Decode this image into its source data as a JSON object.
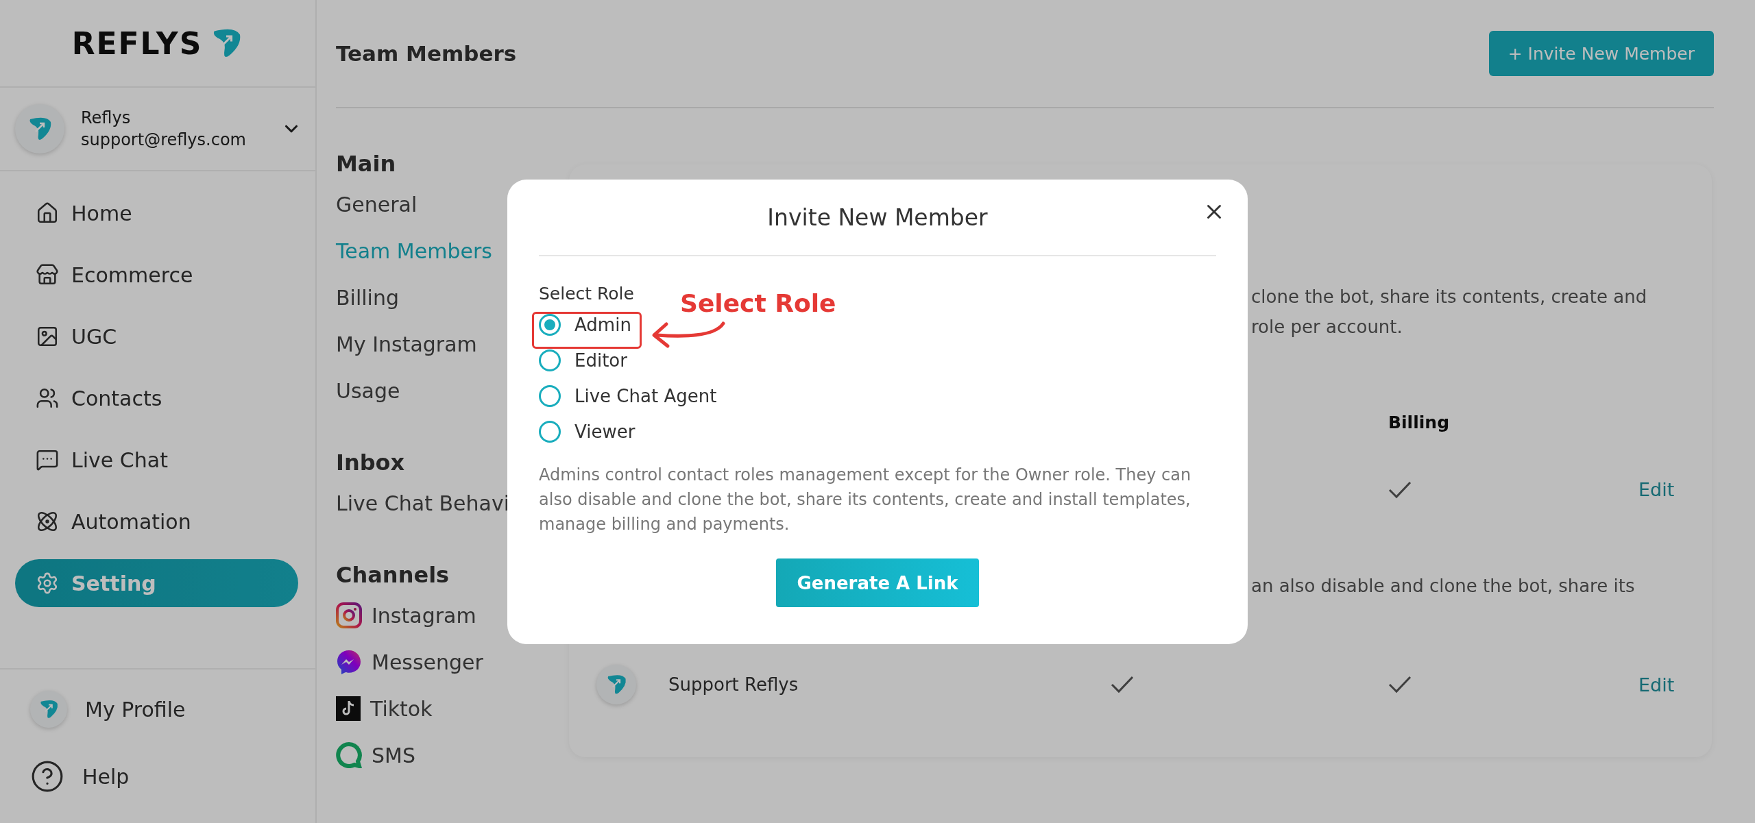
{
  "brand": {
    "name": "REFLYS"
  },
  "account": {
    "name": "Reflys",
    "email": "support@reflys.com"
  },
  "nav": [
    {
      "label": "Home",
      "selected": false
    },
    {
      "label": "Ecommerce",
      "selected": false
    },
    {
      "label": "UGC",
      "selected": false
    },
    {
      "label": "Contacts",
      "selected": false
    },
    {
      "label": "Live Chat",
      "selected": false
    },
    {
      "label": "Automation",
      "selected": false
    },
    {
      "label": "Setting",
      "selected": true
    }
  ],
  "footer_nav": [
    {
      "label": "My Profile"
    },
    {
      "label": "Help"
    }
  ],
  "page": {
    "title": "Team Members",
    "invite_button": "+ Invite New Member"
  },
  "settings_nav": [
    {
      "heading": "Main",
      "items": [
        {
          "label": "General",
          "selected": false
        },
        {
          "label": "Team Members",
          "selected": true
        },
        {
          "label": "Billing",
          "selected": false
        },
        {
          "label": "My Instagram",
          "selected": false
        },
        {
          "label": "Usage",
          "selected": false
        }
      ]
    },
    {
      "heading": "Inbox",
      "items": [
        {
          "label": "Live Chat Behavi",
          "selected": false
        }
      ]
    },
    {
      "heading": "Channels",
      "items": [
        {
          "label": "Instagram",
          "selected": false
        },
        {
          "label": "Messenger",
          "selected": false
        },
        {
          "label": "Tiktok",
          "selected": false
        },
        {
          "label": "SMS",
          "selected": false
        }
      ]
    }
  ],
  "card": {
    "intro_lines": [
      "clone the bot, share its contents, create and",
      "role per account."
    ],
    "column_header": "Billing",
    "rows": [
      {
        "kind": "member",
        "billing": true,
        "edit": "Edit"
      },
      {
        "kind": "note",
        "text": "an also disable and clone the bot, share its"
      },
      {
        "kind": "member",
        "name": "Support Reflys",
        "access": true,
        "billing": true,
        "edit": "Edit"
      }
    ]
  },
  "modal": {
    "title": "Invite New Member",
    "role_label": "Select Role",
    "roles": [
      {
        "label": "Admin",
        "selected": true
      },
      {
        "label": "Editor",
        "selected": false
      },
      {
        "label": "Live Chat Agent",
        "selected": false
      },
      {
        "label": "Viewer",
        "selected": false
      }
    ],
    "description": "Admins control contact roles management except for the Owner role. They can also disable and clone the bot, share its contents, create and install templates, manage billing and payments.",
    "button": "Generate A Link",
    "annotation": {
      "text": "Select Role"
    }
  }
}
